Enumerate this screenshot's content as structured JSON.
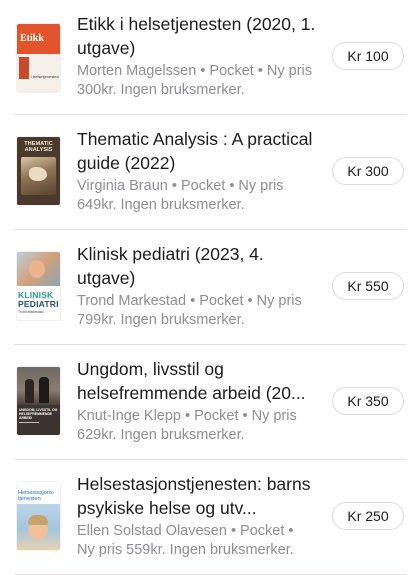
{
  "items": [
    {
      "title": "Etikk i helsetjenesten (2020, 1. utgave)",
      "author": "Morten Magelssen",
      "meta_rest": " • Pocket • Ny pris 300kr. Ingen bruksmerker.",
      "price": "Kr 100",
      "cover": {
        "title": "Etikk",
        "subtitle": "i helsetjenesten"
      }
    },
    {
      "title": "Thematic Analysis : A practical guide  (2022)",
      "author": "Virginia Braun",
      "meta_rest": " • Pocket • Ny pris 649kr. Ingen bruksmerker.",
      "price": "Kr 300",
      "cover": {
        "title": "THEMATIC ANALYSIS"
      }
    },
    {
      "title": "Klinisk pediatri (2023, 4. utgave)",
      "author": "Trond Markestad",
      "meta_rest": " • Pocket • Ny pris 799kr. Ingen bruksmerker.",
      "price": "Kr 550",
      "cover": {
        "title_line1": "KLINISK",
        "title_line2": "PEDIATRI",
        "author": "Trond Markestad"
      }
    },
    {
      "title": "Ungdom, livsstil og helsefremmende arbeid (20...",
      "author": "Knut-Inge Klepp",
      "meta_rest": " • Pocket • Ny pris 629kr. Ingen bruksmerker.",
      "price": "Kr 350",
      "cover": {
        "title": "UNGDOM, LIVSSTIL OG HELSEFREMMENDE ARBEID"
      }
    },
    {
      "title": "Helsestasjonstjenesten: barns psykiske helse og utv...",
      "author": "Ellen Solstad Olavesen",
      "meta_rest": " • Pocket • Ny pris 559kr. Ingen bruksmerker.",
      "price": "Kr 250",
      "cover": {
        "title": "Helsestasjons-tjenesten"
      }
    }
  ]
}
